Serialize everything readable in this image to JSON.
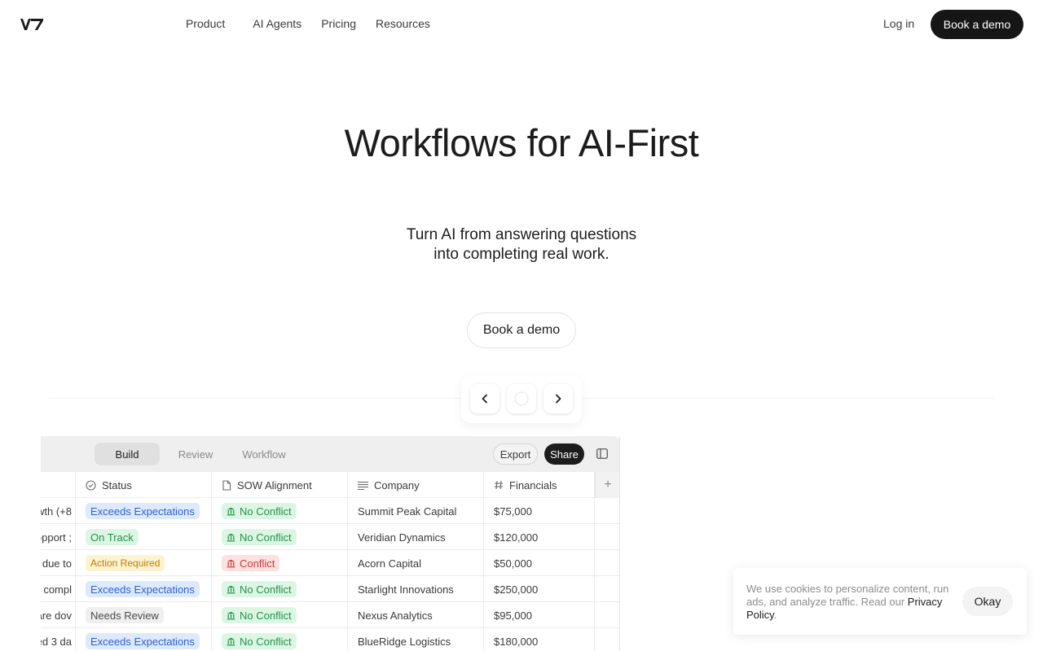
{
  "nav": {
    "logo": "V7",
    "links": [
      "Product",
      "AI Agents",
      "Pricing",
      "Resources"
    ],
    "login": "Log in",
    "cta": "Book a demo"
  },
  "hero": {
    "title": "Workflows for AI-First",
    "subtitle_line1": "Turn AI from answering questions",
    "subtitle_line2": "into completing real work.",
    "cta": "Book a demo"
  },
  "app": {
    "tabs": [
      "Build",
      "Review",
      "Workflow"
    ],
    "active_tab": "Build",
    "export_label": "Export",
    "share_label": "Share",
    "columns": [
      "Status",
      "SOW Alignment",
      "Company",
      "Financials"
    ],
    "add_column": "+",
    "rows": [
      {
        "fragment": "wth (+8",
        "status": "Exceeds Expectations",
        "status_color": "blue",
        "sow": "No Conflict",
        "sow_color": "green",
        "company": "Summit Peak Capital",
        "financials": "$75,000"
      },
      {
        "fragment": "; opport",
        "status": "On Track",
        "status_color": "green",
        "sow": "No Conflict",
        "sow_color": "green",
        "company": "Veridian Dynamics",
        "financials": "$120,000"
      },
      {
        "fragment": "l due to",
        "status": "Action Required",
        "status_color": "yellow",
        "sow": "Conflict",
        "sow_color": "red",
        "company": "Acorn Capital",
        "financials": "$50,000"
      },
      {
        "fragment": "nt compl",
        "status": "Exceeds Expectations",
        "status_color": "blue",
        "sow": "No Conflict",
        "sow_color": "green",
        "company": "Starlight Innovations",
        "financials": "$250,000"
      },
      {
        "fragment": "are dov",
        "status": "Needs Review",
        "status_color": "gray",
        "sow": "No Conflict",
        "sow_color": "green",
        "company": "Nexus Analytics",
        "financials": "$95,000"
      },
      {
        "fragment": "ed 3 da",
        "status": "Exceeds Expectations",
        "status_color": "blue",
        "sow": "No Conflict",
        "sow_color": "green",
        "company": "BlueRidge Logistics",
        "financials": "$180,000"
      }
    ]
  },
  "cookie": {
    "text": "We use cookies to personalize content, run ads, and analyze traffic. Read our ",
    "link": "Privacy Policy",
    "suffix": ".",
    "button": "Okay"
  },
  "icons": {
    "carousel_prev": "chevron-left-icon",
    "carousel_next": "chevron-right-icon",
    "status_col": "check-circle-icon",
    "sow_col": "document-icon",
    "company_col": "text-lines-icon",
    "financials_col": "hash-icon",
    "sow_badge": "bank-icon"
  }
}
